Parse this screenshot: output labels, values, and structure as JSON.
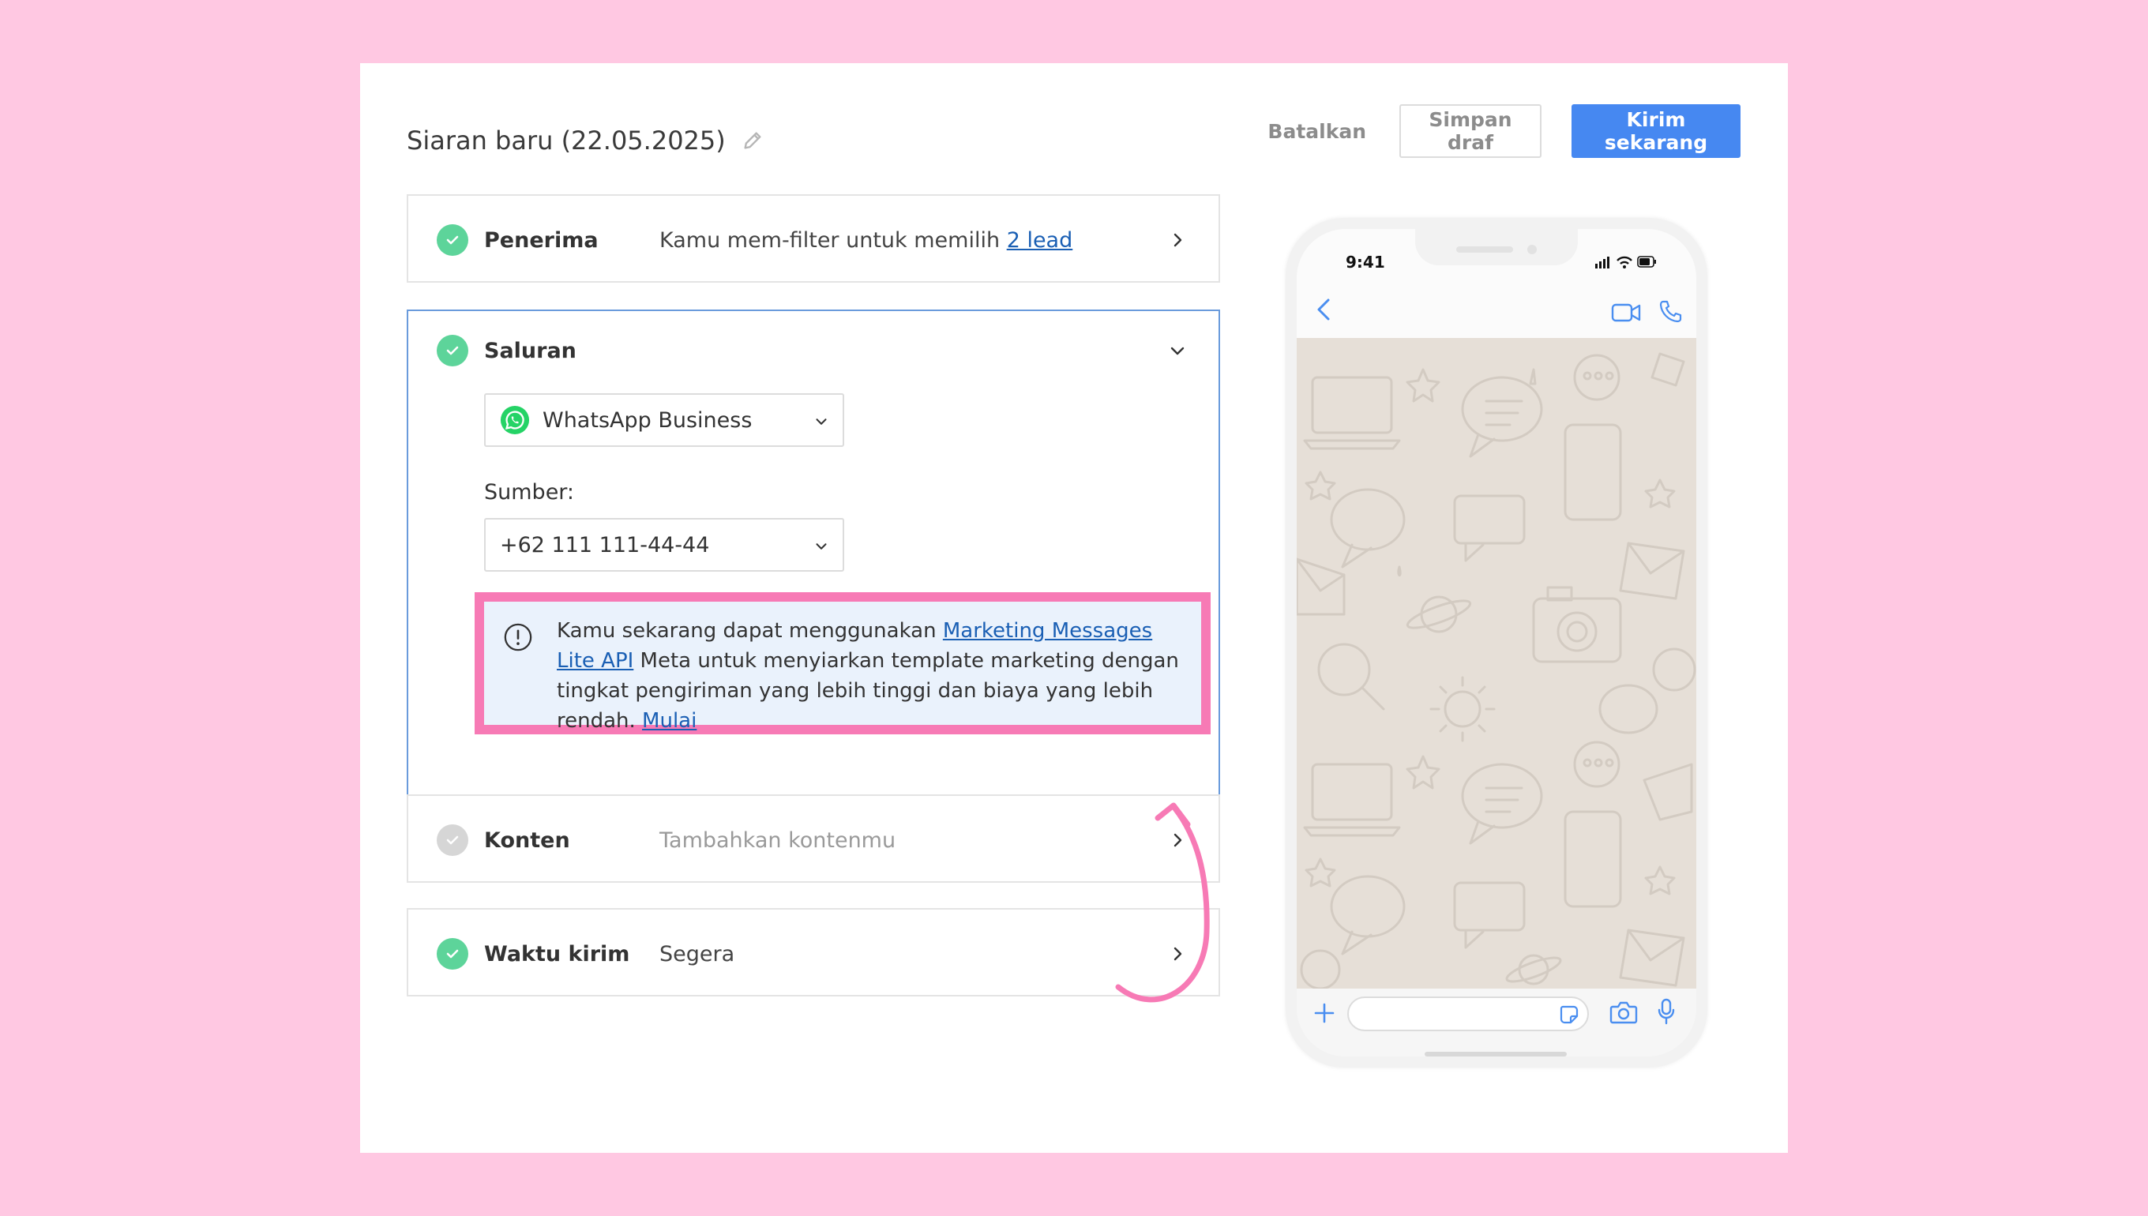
{
  "header": {
    "title": "Siaran baru (22.05.2025)",
    "cancel_label": "Batalkan",
    "draft_label": "Simpan draf",
    "send_label": "Kirim sekarang"
  },
  "sections": {
    "recipients": {
      "label": "Penerima",
      "text": "Kamu mem-filter untuk memilih ",
      "link": "2 lead"
    },
    "channel": {
      "label": "Saluran",
      "channel_value": "WhatsApp Business",
      "source_label": "Sumber:",
      "source_value": "+62 111 111-44-44",
      "notice": {
        "text_before": "Kamu sekarang dapat menggunakan ",
        "link_api": "Marketing Messages Lite API",
        "text_after": " Meta untuk menyiarkan template marketing dengan tingkat pengiriman yang lebih tinggi dan biaya yang lebih rendah. ",
        "link_start": "Mulai"
      }
    },
    "content": {
      "label": "Konten",
      "placeholder": "Tambahkan kontenmu"
    },
    "send_time": {
      "label": "Waktu kirim",
      "value": "Segera"
    }
  },
  "phone_preview": {
    "time": "9:41"
  },
  "colors": {
    "background": "#ffc8e2",
    "accent": "#4688f1",
    "success": "#5dd49a",
    "highlight": "#f77ab5",
    "link": "#1a5fb4"
  }
}
